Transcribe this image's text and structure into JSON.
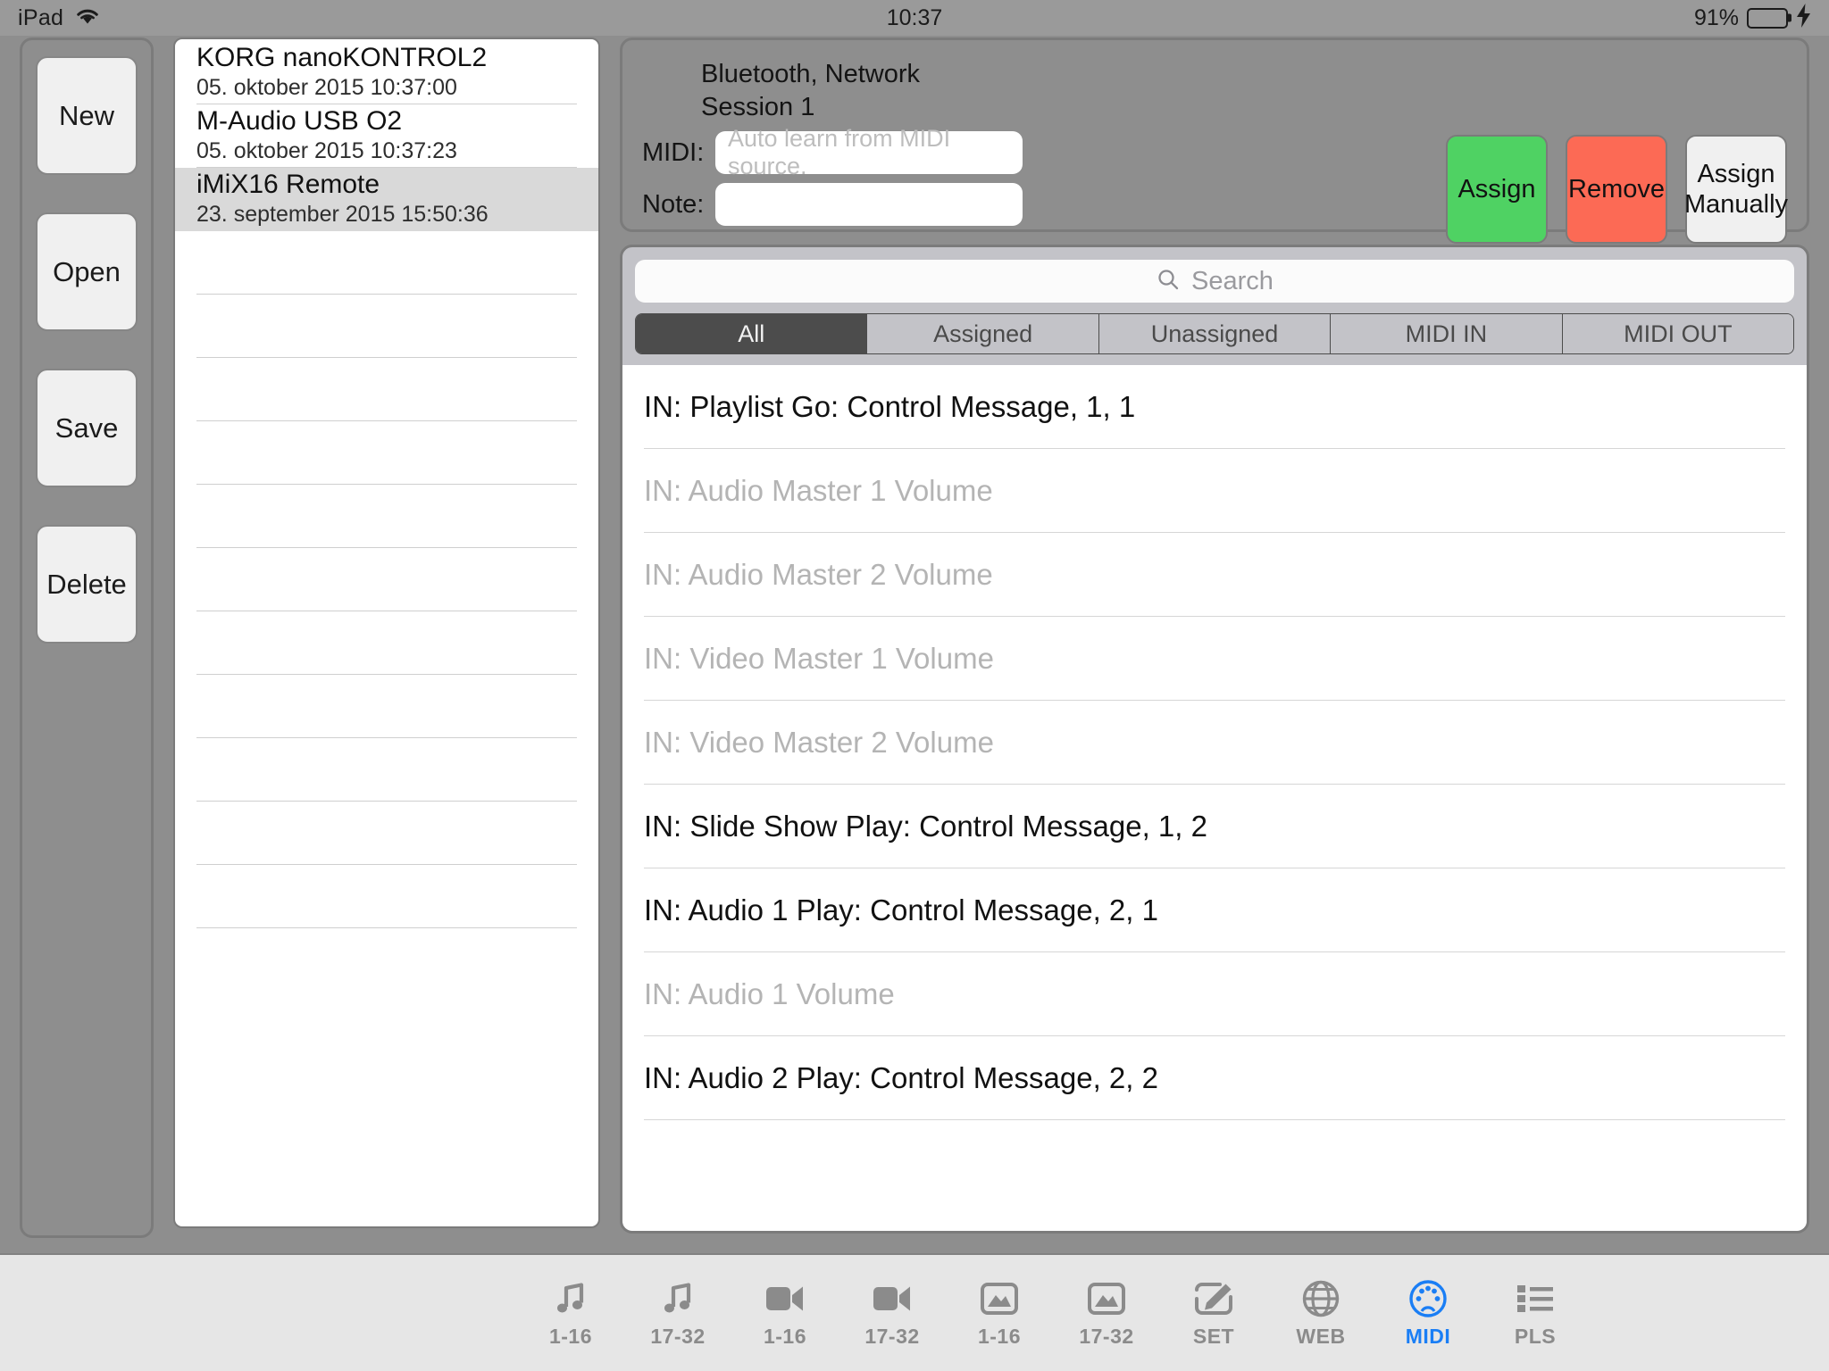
{
  "status_bar": {
    "device": "iPad",
    "wifi_icon": "wifi-icon",
    "time": "10:37",
    "battery_percent": "91%",
    "battery_fill_color": "#4cd364",
    "charging_icon": "lightning-bolt-icon"
  },
  "file_ops": {
    "buttons": [
      {
        "label": "New",
        "name": "new-button"
      },
      {
        "label": "Open",
        "name": "open-button"
      },
      {
        "label": "Save",
        "name": "save-button"
      },
      {
        "label": "Delete",
        "name": "delete-button"
      }
    ]
  },
  "device_list": {
    "items": [
      {
        "name": "KORG nanoKONTROL2",
        "date": "05. oktober 2015 10:37:00",
        "selected": false
      },
      {
        "name": "M-Audio USB O2",
        "date": "05. oktober 2015 10:37:23",
        "selected": false
      },
      {
        "name": "iMiX16 Remote",
        "date": "23. september 2015 15:50:36",
        "selected": true
      }
    ],
    "empty_row_count": 11
  },
  "assignment_panel": {
    "session_line_1": "Bluetooth, Network",
    "session_line_2": "Session 1",
    "midi_label": "MIDI:",
    "midi_placeholder": "Auto learn from MIDI source.",
    "midi_value": "",
    "note_label": "Note:",
    "note_placeholder": "",
    "note_value": "",
    "buttons": [
      {
        "label": "Assign",
        "name": "assign-button",
        "color": "#4fd263"
      },
      {
        "label": "Remove",
        "name": "remove-button",
        "color": "#fc6a55"
      },
      {
        "label": "Assign\nManually",
        "name": "assign-manually-button",
        "color": "#f0f0f0"
      }
    ],
    "assign_manually_line_1": "Assign",
    "assign_manually_line_2": "Manually"
  },
  "search": {
    "placeholder": "Search",
    "value": "",
    "icon": "search-icon"
  },
  "filter_tabs": {
    "items": [
      {
        "label": "All",
        "active": true
      },
      {
        "label": "Assigned",
        "active": false
      },
      {
        "label": "Unassigned",
        "active": false
      },
      {
        "label": "MIDI IN",
        "active": false
      },
      {
        "label": "MIDI OUT",
        "active": false
      }
    ]
  },
  "midi_list": {
    "rows": [
      {
        "label": "IN: Playlist Go: Control Message, 1, 1",
        "assigned": true
      },
      {
        "label": "IN: Audio Master 1 Volume",
        "assigned": false
      },
      {
        "label": "IN: Audio Master 2 Volume",
        "assigned": false
      },
      {
        "label": "IN: Video Master 1 Volume",
        "assigned": false
      },
      {
        "label": "IN: Video Master 2 Volume",
        "assigned": false
      },
      {
        "label": "IN: Slide Show Play: Control Message, 1, 2",
        "assigned": true
      },
      {
        "label": "IN: Audio 1 Play: Control Message, 2, 1",
        "assigned": true
      },
      {
        "label": "IN: Audio 1 Volume",
        "assigned": false
      },
      {
        "label": "IN: Audio 2 Play: Control Message, 2, 2",
        "assigned": true
      }
    ]
  },
  "tab_bar": {
    "active_color": "#1a7ef5",
    "inactive_color": "#8b8b8b",
    "items": [
      {
        "label": "1-16",
        "icon": "music-note-icon",
        "name": "tab-audio-1-16",
        "active": false
      },
      {
        "label": "17-32",
        "icon": "music-note-icon",
        "name": "tab-audio-17-32",
        "active": false
      },
      {
        "label": "1-16",
        "icon": "video-camera-icon",
        "name": "tab-video-1-16",
        "active": false
      },
      {
        "label": "17-32",
        "icon": "video-camera-icon",
        "name": "tab-video-17-32",
        "active": false
      },
      {
        "label": "1-16",
        "icon": "image-icon",
        "name": "tab-image-1-16",
        "active": false
      },
      {
        "label": "17-32",
        "icon": "image-icon",
        "name": "tab-image-17-32",
        "active": false
      },
      {
        "label": "SET",
        "icon": "pencil-edit-icon",
        "name": "tab-set",
        "active": false
      },
      {
        "label": "WEB",
        "icon": "globe-icon",
        "name": "tab-web",
        "active": false
      },
      {
        "label": "MIDI",
        "icon": "midi-din-icon",
        "name": "tab-midi",
        "active": true
      },
      {
        "label": "PLS",
        "icon": "list-icon",
        "name": "tab-pls",
        "active": false
      }
    ]
  }
}
